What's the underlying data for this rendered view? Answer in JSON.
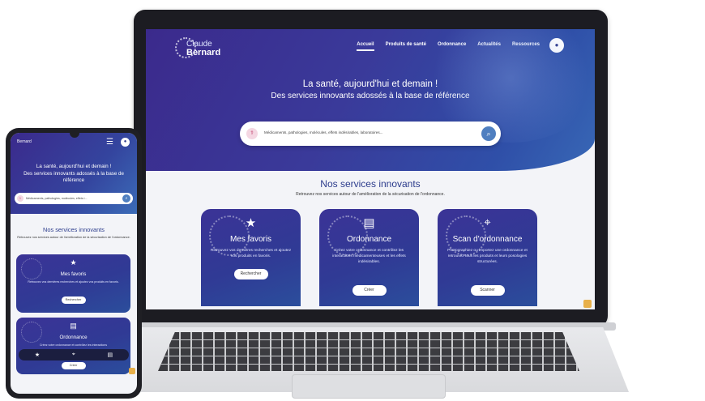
{
  "desktop": {
    "logo": {
      "line1": "Claude",
      "line2": "Bernard"
    },
    "nav": [
      "Accueil",
      "Produits de santé",
      "Ordonnance",
      "Actualités",
      "Ressources"
    ],
    "hero_title": "La santé, aujourd'hui et demain !",
    "hero_subtitle": "Des services innovants adossés à la base de référence",
    "search_placeholder": "Médicaments, pathologies, molécules, effets indésirables, laboratoires...",
    "section_title": "Nos services innovants",
    "section_subtitle": "Retrouvez nos services autour de l'amélioration de la sécurisation de l'ordonnance.",
    "cards": [
      {
        "icon": "★",
        "title": "Mes favoris",
        "desc": "Retrouvez vos dernières recherches et ajoutez vos produits en favoris.",
        "button": "Rechercher"
      },
      {
        "icon": "▤",
        "title": "Ordonnance",
        "desc": "Créez votre ordonnance et contrôlez les interactions médicamenteuses et les effets indésirables.",
        "button": "Créer"
      },
      {
        "icon": "⌖",
        "title": "Scan d'ordonnance",
        "desc": "Photographiez ou importez une ordonnance et retrouvez tous les produits et leurs posologies structurées.",
        "button": "Scanner"
      }
    ]
  },
  "mobile": {
    "logo": "Bernard",
    "hero_title": "La santé, aujourd'hui et demain !",
    "hero_subtitle": "Des services innovants adossés à la base de référence",
    "search_placeholder": "Médicaments, pathologies, molécules, effets i...",
    "section_title": "Nos services innovants",
    "section_subtitle": "Retrouvez nos services autour de l'amélioration de la sécurisation de l'ordonnance.",
    "cards": [
      {
        "icon": "★",
        "title": "Mes favoris",
        "desc": "Retrouvez vos dernières recherches et ajoutez vos produits en favoris.",
        "button": "Rechercher"
      },
      {
        "icon": "▤",
        "title": "Ordonnance",
        "desc": "Créez votre ordonnance et contrôlez les interactions",
        "button": "Créer"
      }
    ],
    "bottom_bar": [
      "★",
      "⌖",
      "▤"
    ]
  },
  "colors": {
    "brand_dark": "#3b2a8c",
    "brand_blue": "#3868b6",
    "title_blue": "#2c3c8c",
    "accent": "#e8b04a"
  }
}
